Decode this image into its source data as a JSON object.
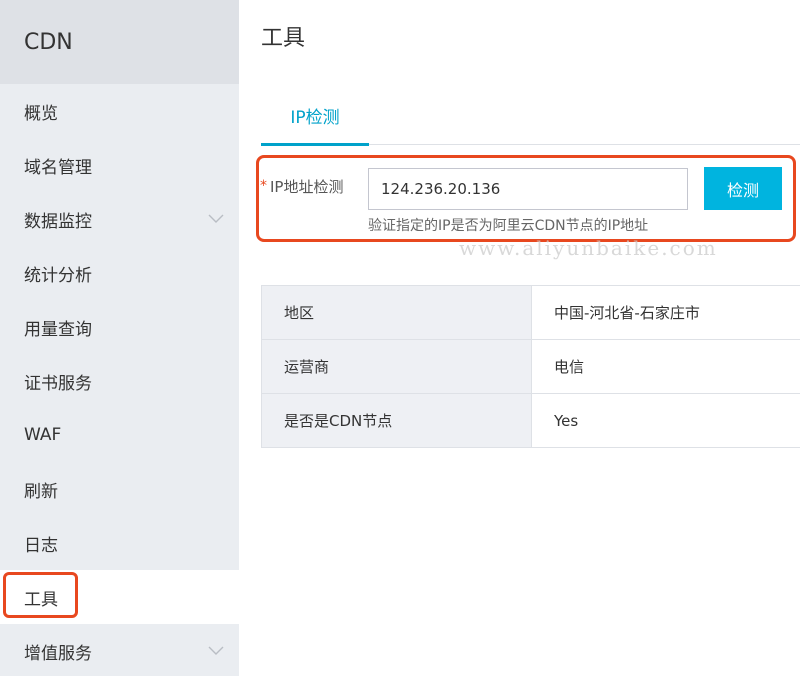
{
  "sidebar": {
    "title": "CDN",
    "items": [
      {
        "label": "概览"
      },
      {
        "label": "域名管理"
      },
      {
        "label": "数据监控"
      },
      {
        "label": "统计分析"
      },
      {
        "label": "用量查询"
      },
      {
        "label": "证书服务"
      },
      {
        "label": "WAF"
      },
      {
        "label": "刷新"
      },
      {
        "label": "日志"
      },
      {
        "label": "工具"
      },
      {
        "label": "增值服务"
      }
    ]
  },
  "main": {
    "title": "工具",
    "tab_label": "IP检测",
    "form": {
      "required_mark": "*",
      "label": "IP地址检测",
      "ip_value": "124.236.20.136",
      "help_text": "验证指定的IP是否为阿里云CDN节点的IP地址",
      "button_label": "检测"
    },
    "watermark": "www.aliyunbaike.com",
    "results": [
      {
        "key": "地区",
        "value": "中国-河北省-石家庄市"
      },
      {
        "key": "运营商",
        "value": "电信"
      },
      {
        "key": "是否是CDN节点",
        "value": "Yes"
      }
    ]
  },
  "colors": {
    "accent": "#00a2ca",
    "button": "#00b4df",
    "highlight": "#e8481f",
    "sidebar_bg": "#eaedf1"
  }
}
